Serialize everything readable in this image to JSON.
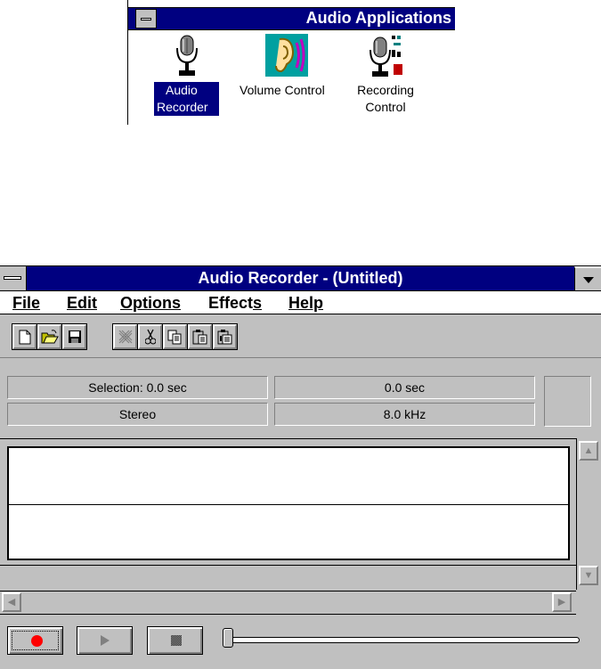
{
  "group_window": {
    "title": "Audio Applications",
    "icons": [
      {
        "label_line1": "Audio",
        "label_line2": "Recorder",
        "icon": "microphone-icon",
        "selected": true
      },
      {
        "label": "Volume Control",
        "icon": "ear-sound-icon"
      },
      {
        "label_line1": "Recording",
        "label_line2": "Control",
        "icon": "microphone-mixer-icon"
      }
    ]
  },
  "recorder": {
    "title": "Audio Recorder - (Untitled)",
    "menu": [
      "File",
      "Edit",
      "Options",
      "Effects",
      "Help"
    ],
    "toolbar": [
      [
        "new-icon",
        "open-icon",
        "save-icon"
      ],
      [
        "delete-icon",
        "cut-icon",
        "copy-icon",
        "paste-icon",
        "paste-insert-icon"
      ]
    ],
    "selection": "Selection: 0.0 sec",
    "position": "0.0 sec",
    "channels": "Stereo",
    "sample_rate": "8.0 kHz",
    "buttons": [
      "record-button",
      "play-button",
      "stop-button"
    ],
    "slider_position": 0,
    "accent": "#000080",
    "record_color": "#ff0000"
  }
}
